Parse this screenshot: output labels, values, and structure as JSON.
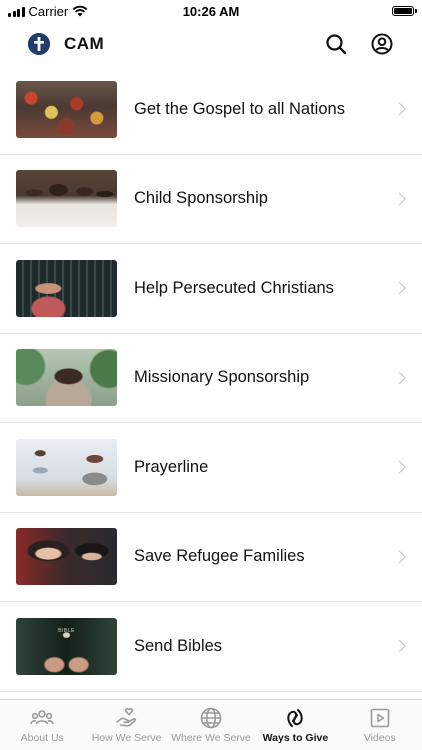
{
  "status_bar": {
    "carrier": "Carrier",
    "time": "10:26 AM"
  },
  "header": {
    "logo_icon": "cross-logo-icon",
    "title": "CAM",
    "actions": [
      "search-icon",
      "account-icon"
    ]
  },
  "list": {
    "items": [
      {
        "label": "Get the Gospel to all Nations",
        "image": "crowd-of-people-photo"
      },
      {
        "label": "Child Sponsorship",
        "image": "children-in-classroom-photo"
      },
      {
        "label": "Help Persecuted Christians",
        "image": "woman-behind-bars-photo"
      },
      {
        "label": "Missionary Sponsorship",
        "image": "smiling-man-portrait-photo"
      },
      {
        "label": "Prayerline",
        "image": "children-outdoors-photo"
      },
      {
        "label": "Save Refugee Families",
        "image": "mother-and-child-photo"
      },
      {
        "label": "Send Bibles",
        "image": "hands-holding-bible-photo",
        "book_text": "BIBLE"
      }
    ]
  },
  "tab_bar": {
    "tabs": [
      {
        "label": "About Us",
        "icon": "people-group-icon",
        "active": false
      },
      {
        "label": "How We Serve",
        "icon": "hand-heart-icon",
        "active": false
      },
      {
        "label": "Where We Serve",
        "icon": "globe-icon",
        "active": false
      },
      {
        "label": "Ways to Give",
        "icon": "heart-hand-icon",
        "active": true
      },
      {
        "label": "Videos",
        "icon": "play-video-icon",
        "active": false
      }
    ]
  },
  "colors": {
    "brand": "#1f3e6e",
    "active_tab": "#111111",
    "inactive_tab": "#9a9a9a",
    "divider": "#e6e6e6"
  }
}
